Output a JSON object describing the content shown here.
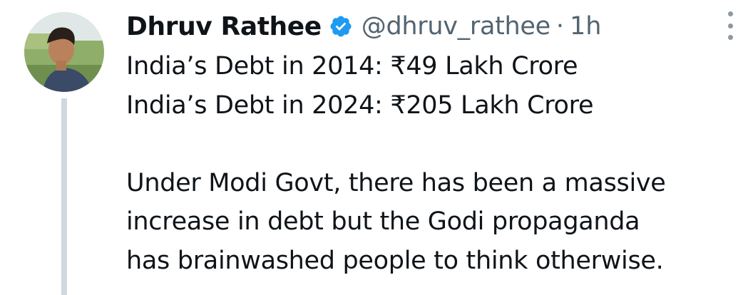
{
  "author": {
    "name": "Dhruv Rathee",
    "handle": "@dhruv_rathee",
    "separator": "·",
    "time": "1h",
    "avatar_icon": "profile-photo",
    "verified_icon": "verified-badge-icon"
  },
  "tweet": {
    "lines": [
      "India’s Debt in 2014: ₹49 Lakh Crore",
      "India’s Debt in 2024: ₹205 Lakh Crore"
    ],
    "paragraph_lines": [
      "Under Modi Govt, there has been a massive",
      "increase in debt but the Godi propaganda",
      "has brainwashed people to think otherwise."
    ]
  },
  "colors": {
    "text": "#0f1419",
    "secondary": "#536471",
    "verified": "#1d9bf0",
    "thread_line": "#cfd9de"
  },
  "icons": {
    "more": "more-options-icon"
  }
}
